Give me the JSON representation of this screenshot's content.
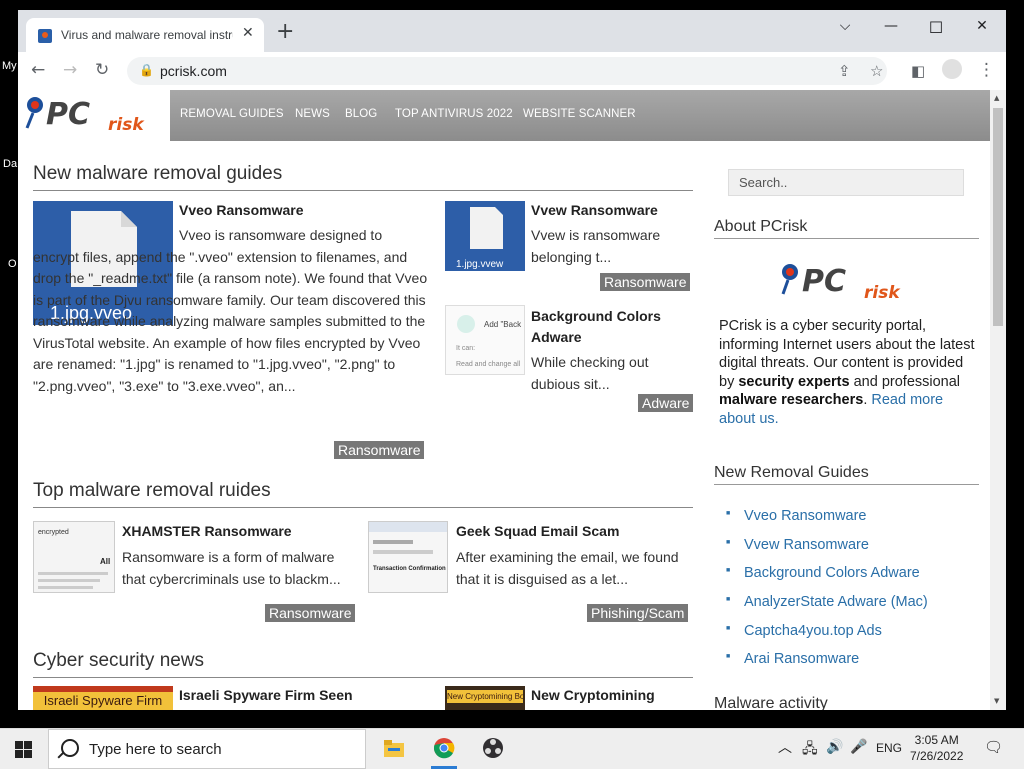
{
  "desktop": {
    "icon_labels": [
      "My",
      "Da",
      "O"
    ]
  },
  "browser": {
    "tab_title": "Virus and malware removal instructions",
    "url": "pcrisk.com"
  },
  "site": {
    "logo_text": "PC",
    "logo_sub": "risk",
    "nav": [
      "REMOVAL GUIDES",
      "NEWS",
      "BLOG",
      "TOP ANTIVIRUS 2022",
      "WEBSITE SCANNER"
    ]
  },
  "sections": {
    "new_guides": "New malware removal guides",
    "top_guides": "Top malware removal ruides",
    "news": "Cyber security news"
  },
  "articles": {
    "vveo": {
      "title": "Vveo Ransomware",
      "text": "Vveo is ransomware designed to encrypt files, append the \".vveo\" extension to filenames, and drop the \"_readme.txt\" file (a ransom note). We found that Vveo is part of the Djvu ransomware family. Our team discovered this ransomware while analyzing malware samples submitted to the VirusTotal website. An example of how files encrypted by Vveo are renamed: \"1.jpg\" is renamed to \"1.jpg.vveo\", \"2.png\" to \"2.png.vveo\", \"3.exe\" to \"3.exe.vveo\", an...",
      "thumb_label": "1.jpg.vveo",
      "badge": "Ransomware"
    },
    "vvew": {
      "title": "Vvew Ransomware",
      "text": "Vvew is ransomware belonging t...",
      "thumb_label": "1.jpg.vvew",
      "badge": "Ransomware"
    },
    "bgcolors": {
      "title": "Background Colors Adware",
      "text": "While checking out dubious sit...",
      "thumb_label_1": "Add \"Back",
      "thumb_label_2": "It can:",
      "thumb_label_3": "Read and change all",
      "badge": "Adware"
    },
    "xhamster": {
      "title": "XHAMSTER Ransomware",
      "text": "Ransomware is a form of malware that cybercriminals use to blackm...",
      "thumb_label_1": "encrypted",
      "thumb_label_2": "All",
      "badge": "Ransomware"
    },
    "geeksquad": {
      "title": "Geek Squad Email Scam",
      "text": "After examining the email, we found that it is disguised as a let...",
      "thumb_label_1": "Transaction Confirmation",
      "badge": "Phishing/Scam"
    },
    "israeli": {
      "title": "Israeli Spyware Firm Seen",
      "thumb_label": "Israeli Spyware Firm"
    },
    "cryptomining": {
      "title": "New Cryptomining",
      "thumb_label": "New Cryptomining Bo"
    }
  },
  "sidebar": {
    "search_placeholder": "Search..",
    "about_heading": "About PCrisk",
    "about_text_1": "PCrisk is a cyber security portal, informing Internet users about the latest digital threats. Our content is provided by ",
    "about_bold_1": "security experts",
    "about_text_2": " and professional ",
    "about_bold_2": "malware researchers",
    "about_text_3": ". ",
    "about_link": "Read more about us.",
    "new_guides_heading": "New Removal Guides",
    "new_guides": [
      "Vveo Ransomware",
      "Vvew Ransomware",
      "Background Colors Adware",
      "AnalyzerState Adware (Mac)",
      "Captcha4you.top Ads",
      "Arai Ransomware"
    ],
    "malware_activity_heading": "Malware activity"
  },
  "taskbar": {
    "search_placeholder": "Type here to search",
    "lang": "ENG",
    "time": "3:05 AM",
    "date": "7/26/2022"
  }
}
